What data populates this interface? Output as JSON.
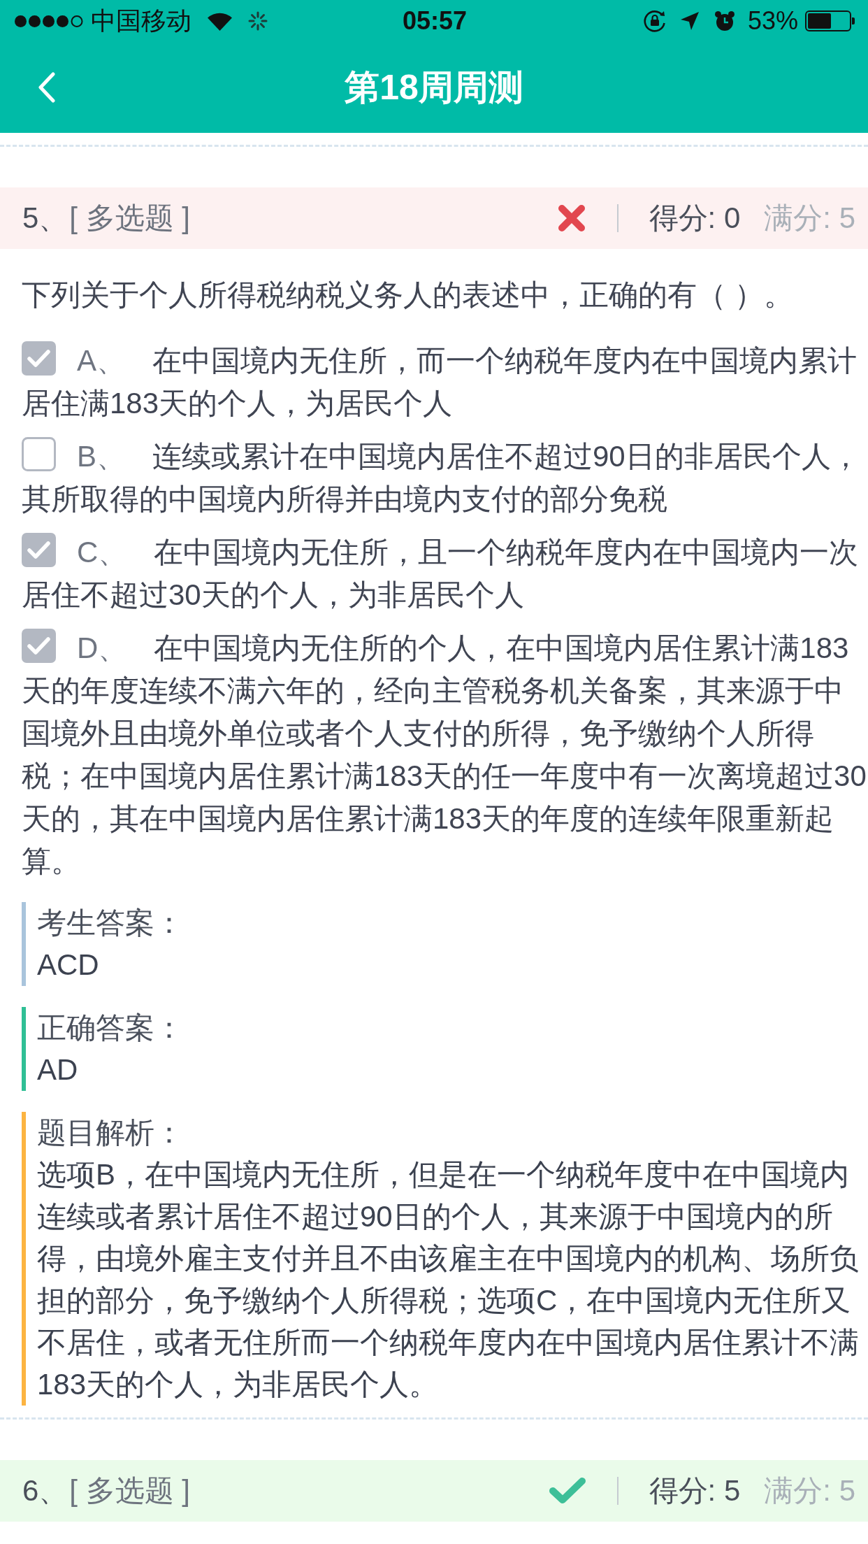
{
  "status_bar": {
    "carrier": "中国移动",
    "time": "05:57",
    "battery": "53%"
  },
  "header": {
    "title": "第18周周测"
  },
  "questions": [
    {
      "number": "5、",
      "type": "[ 多选题 ]",
      "correct": false,
      "score": "得分: 0",
      "full_score": "满分: 5",
      "prompt": "下列关于个人所得税纳税义务人的表述中，正确的有（ ）。",
      "options": [
        {
          "label": "A、",
          "text": "在中国境内无住所，而一个纳税年度内在中国境内累计居住满183天的个人，为居民个人",
          "checked": true
        },
        {
          "label": "B、",
          "text": "连续或累计在中国境内居住不超过90日的非居民个人，其所取得的中国境内所得并由境内支付的部分免税",
          "checked": false
        },
        {
          "label": "C、",
          "text": "在中国境内无住所，且一个纳税年度内在中国境内一次居住不超过30天的个人，为非居民个人",
          "checked": true
        },
        {
          "label": "D、",
          "text": "在中国境内无住所的个人，在中国境内居住累计满183天的年度连续不满六年的，经向主管税务机关备案，其来源于中国境外且由境外单位或者个人支付的所得，免予缴纳个人所得税；在中国境内居住累计满183天的任一年度中有一次离境超过30天的，其在中国境内居住累计满183天的年度的连续年限重新起算。",
          "checked": true
        }
      ],
      "answers": [
        {
          "kind": "student",
          "label": "考生答案：",
          "value": "ACD"
        },
        {
          "kind": "correct",
          "label": "正确答案：",
          "value": "AD"
        },
        {
          "kind": "explanation",
          "label": "题目解析：",
          "value": "选项B，在中国境内无住所，但是在一个纳税年度中在中国境内连续或者累计居住不超过90日的个人，其来源于中国境内的所得，由境外雇主支付并且不由该雇主在中国境内的机构、场所负担的部分，免予缴纳个人所得税；选项C，在中国境内无住所又不居住，或者无住所而一个纳税年度内在中国境内居住累计不满183天的个人，为非居民个人。"
        }
      ]
    },
    {
      "number": "6、",
      "type": "[ 多选题 ]",
      "correct": true,
      "score": "得分: 5",
      "full_score": "满分: 5"
    }
  ]
}
